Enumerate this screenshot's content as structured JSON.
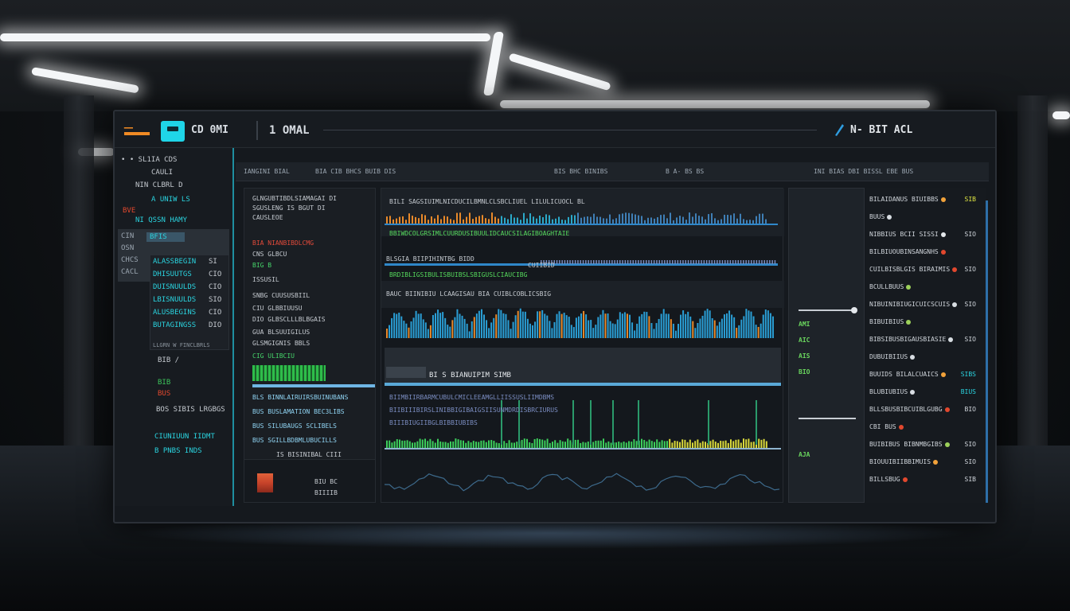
{
  "header": {
    "app_name": "CD 0MI",
    "tab_title": "1 OMAL",
    "right_title": "N- BIT  ACL"
  },
  "sidebar": {
    "lines": [
      {
        "text": "• •  SL1IA CDS",
        "cls": ""
      },
      {
        "text": "CAULI",
        "cls": ""
      },
      {
        "text": "   NIN CLBRL  D",
        "cls": ""
      },
      {
        "text": "A  UNIW LS",
        "cls": "sb-cyan"
      },
      {
        "text": "BVE",
        "cls": "sb-red"
      },
      {
        "text": "NI  QSSN  HAMY",
        "cls": "sb-cyan"
      }
    ],
    "block_labels": [
      "CIN",
      "OSN",
      "CHCS",
      "CACL"
    ],
    "active_label": "BFIS",
    "panel_rows": [
      {
        "left": "ALASSBEGIN",
        "right": "SI"
      },
      {
        "left": "DHISUUTGS",
        "right": "CIO"
      },
      {
        "left": "DUISNUULDS",
        "right": "CIO"
      },
      {
        "left": "LBISNUULDS",
        "right": "SIO"
      },
      {
        "left": "ALUSBEGINS",
        "right": "CIO"
      },
      {
        "left": "BUTAGINGSS",
        "right": "DIO"
      }
    ],
    "panel_footer": "LLGRN   W  FINCLBRLS",
    "lower": [
      {
        "text": "BIB  /",
        "cls": ""
      },
      {
        "text": "BIB",
        "cls": "sb-green"
      },
      {
        "text": "BUS",
        "cls": "sb-red"
      },
      {
        "text": "BOS  SIBIS   LRGBGS",
        "cls": ""
      },
      {
        "text": "CIUNIUUN IIDMT",
        "cls": "sb-cyan"
      },
      {
        "text": "B  PNBS INDS",
        "cls": "sb-cyan"
      }
    ]
  },
  "toolbar": {
    "items": [
      "IANGINI BIAL",
      "BIA CIB  BHCS BUIB  DIS",
      "BIS  BHC BINIBS",
      "B  A- BS BS",
      "INI BIAS  DBI  BISSL  EBE  BUS"
    ]
  },
  "midleft": {
    "rows": [
      {
        "text": "GLNGUBTIBDLSIAMAGAI DI",
        "cls": ""
      },
      {
        "text": "SGUSLENG IS  BGUT  DI",
        "cls": ""
      },
      {
        "text": "CAUSLEOE",
        "cls": ""
      },
      {
        "text": "BIA   NIANBIBDLCMG",
        "cls": "ml-red"
      },
      {
        "text": "CNS  GLBCU",
        "cls": ""
      },
      {
        "text": "BIG  B",
        "cls": "ml-green"
      },
      {
        "text": "ISSUSIL",
        "cls": ""
      },
      {
        "text": "SNBG  CUUSUSBIIL",
        "cls": ""
      },
      {
        "text": "CIU   GLBBIUUSU",
        "cls": ""
      },
      {
        "text": "DIO  GLBSCLLLBLBGAIS",
        "cls": ""
      },
      {
        "text": "GUA  BLSUUIGILUS",
        "cls": ""
      },
      {
        "text": "GLSMGIGNIS  BBLS",
        "cls": ""
      },
      {
        "text": "CIG  ULIBCIU",
        "cls": "ml-green"
      }
    ],
    "lower_rows": [
      "BLS BINNLAIRUIRSBUINUBANS",
      "BUS  BUSLAMATION BEC3LIBS",
      "BUS  SILUBAUGS SCLIBELS",
      "BUS  SGILLBDBMLUBUCILLS"
    ],
    "footer": "IS  BISINIBAL CIII",
    "stack_label": "BIU BC",
    "stack_sub": "BIIIIB"
  },
  "charts": {
    "row1_label": "BILI SAGSIUIMLNICDUCILBMNLCLSBCLIUEL LILULICUOCL BL",
    "row1_sub": "BBIWDCOLGRSIMLCUURDUSIBUULIDCAUCSILAGIBOAGHTAIE",
    "row2_label": "BLSGIA   BIIPIHINTBG BIDD",
    "row2_sub": "BRDIBLIGSIBULISBUIBSLSBIGUSLCIAUCIBG",
    "row2_note": "CUIIBID",
    "row3_label": "BAUC   BIINIBIU   LCAAGISAU   BIA  CUIBLCOBLICSBIG",
    "panel_title": "BI S  BIANUIPIM SIMB",
    "panel_sub": [
      "BIIMBIIRBARMCUBULCMICLEEAMGLLIISSUSLIIMDBMS",
      "BIIBIIIBIRSLINIBBIGIBAIGSIISUNMDRDISBRCIURUS",
      "BIIIBIUGIIBGLBIBBIUBIBS"
    ]
  },
  "slidercol": {
    "labels": [
      "AMI",
      "AIC",
      "AIS",
      "BIO",
      "AJA"
    ]
  },
  "rightlist": {
    "items": [
      {
        "text": "BILAIDANUS BIUIBBS",
        "val": "SIB",
        "valc": "#dfe542",
        "dot": "#f2a23a"
      },
      {
        "text": "BUUS",
        "val": "",
        "valc": "#cfd4da",
        "dot": "#d8dde2"
      },
      {
        "text": "NIBBIUS BCII  SISSI",
        "val": "SIO",
        "valc": "#cfd4da",
        "dot": "#e4e8ec"
      },
      {
        "text": "BILBIUOUBINSANGNHS",
        "val": "",
        "valc": "#cfd4da",
        "dot": "#e2482e"
      },
      {
        "text": "CUILBISBLGIS  BIRAIMIS",
        "val": "SIO",
        "valc": "#cfd4da",
        "dot": "#e2482e"
      },
      {
        "text": "BCULLBUUS",
        "val": "",
        "valc": "#cfd4da",
        "dot": "#9cd05a"
      },
      {
        "text": "NIBUINIBIUGICUICSCUIS",
        "val": "SIO",
        "valc": "#cfd4da",
        "dot": "#d8dde2"
      },
      {
        "text": "BIBUIBIUS",
        "val": "",
        "valc": "#cfd4da",
        "dot": "#9cd05a"
      },
      {
        "text": "BIBSIBUSBIGAUSBIASIE",
        "val": "SIO",
        "valc": "#cfd4da",
        "dot": "#d8dde2"
      },
      {
        "text": "DUBUIBIIUS",
        "val": "",
        "valc": "#cfd4da",
        "dot": "#d8dde2"
      },
      {
        "text": "BUUIDS   BILALCUAICS",
        "val": "SIBS",
        "valc": "#2ad3df",
        "dot": "#f2a23a"
      },
      {
        "text": "BLUBIUBIUS",
        "val": "BIUS",
        "valc": "#2ad3df",
        "dot": "#d8dde2"
      },
      {
        "text": "BLLSBUSBIBCUIBLGUBG",
        "val": "BIO",
        "valc": "#cfd4da",
        "dot": "#e2482e"
      },
      {
        "text": "CBI  BUS",
        "val": "",
        "valc": "#cfd4da",
        "dot": "#e2482e"
      },
      {
        "text": "BUIBIBUS BIBNMBGIBS",
        "val": "SIO",
        "valc": "#cfd4da",
        "dot": "#9cd05a"
      },
      {
        "text": "BIOUUIBIIBBIMUIS",
        "val": "SIO",
        "valc": "#cfd4da",
        "dot": "#f2a23a"
      },
      {
        "text": "BILLSBUG",
        "val": "SIB",
        "valc": "#cfd4da",
        "dot": "#e2482e"
      }
    ]
  }
}
